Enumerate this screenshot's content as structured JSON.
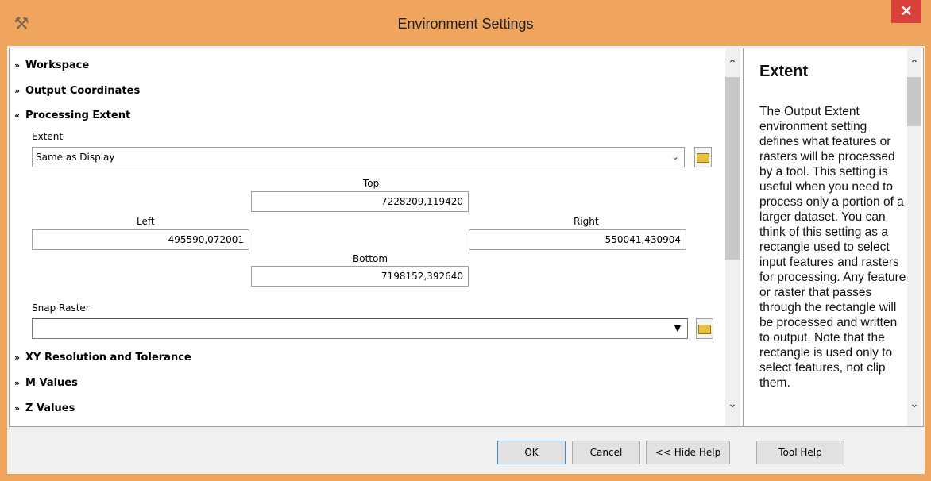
{
  "window": {
    "title": "Environment Settings",
    "close_glyph": "✕",
    "app_icon": "tools-icon"
  },
  "sections": {
    "workspace": "Workspace",
    "output_coordinates": "Output Coordinates",
    "processing_extent": "Processing Extent",
    "xy_resolution": "XY Resolution and Tolerance",
    "m_values": "M Values",
    "z_values": "Z Values",
    "collapsed_glyph": "»",
    "expanded_glyph": "«"
  },
  "extent": {
    "label": "Extent",
    "selected": "Same as Display",
    "top_label": "Top",
    "top_value": "7228209,119420",
    "left_label": "Left",
    "left_value": "495590,072001",
    "right_label": "Right",
    "right_value": "550041,430904",
    "bottom_label": "Bottom",
    "bottom_value": "7198152,392640"
  },
  "snap_raster": {
    "label": "Snap Raster",
    "value": ""
  },
  "help": {
    "title": "Extent",
    "text": "The Output Extent environment setting defines what features or rasters will be processed by a tool. This setting is useful when you need to process only a portion of a larger dataset. You can think of this setting as a rectangle used to select input features and rasters for processing. Any feature or raster that passes through the rectangle will be processed and written to output. Note that the rectangle is used only to select features, not clip them."
  },
  "buttons": {
    "ok": "OK",
    "cancel": "Cancel",
    "hide_help": "<< Hide Help",
    "tool_help": "Tool Help"
  },
  "colors": {
    "title_bar": "#f0a55f",
    "close": "#d9413a",
    "focus_border": "#3c8ccf"
  }
}
